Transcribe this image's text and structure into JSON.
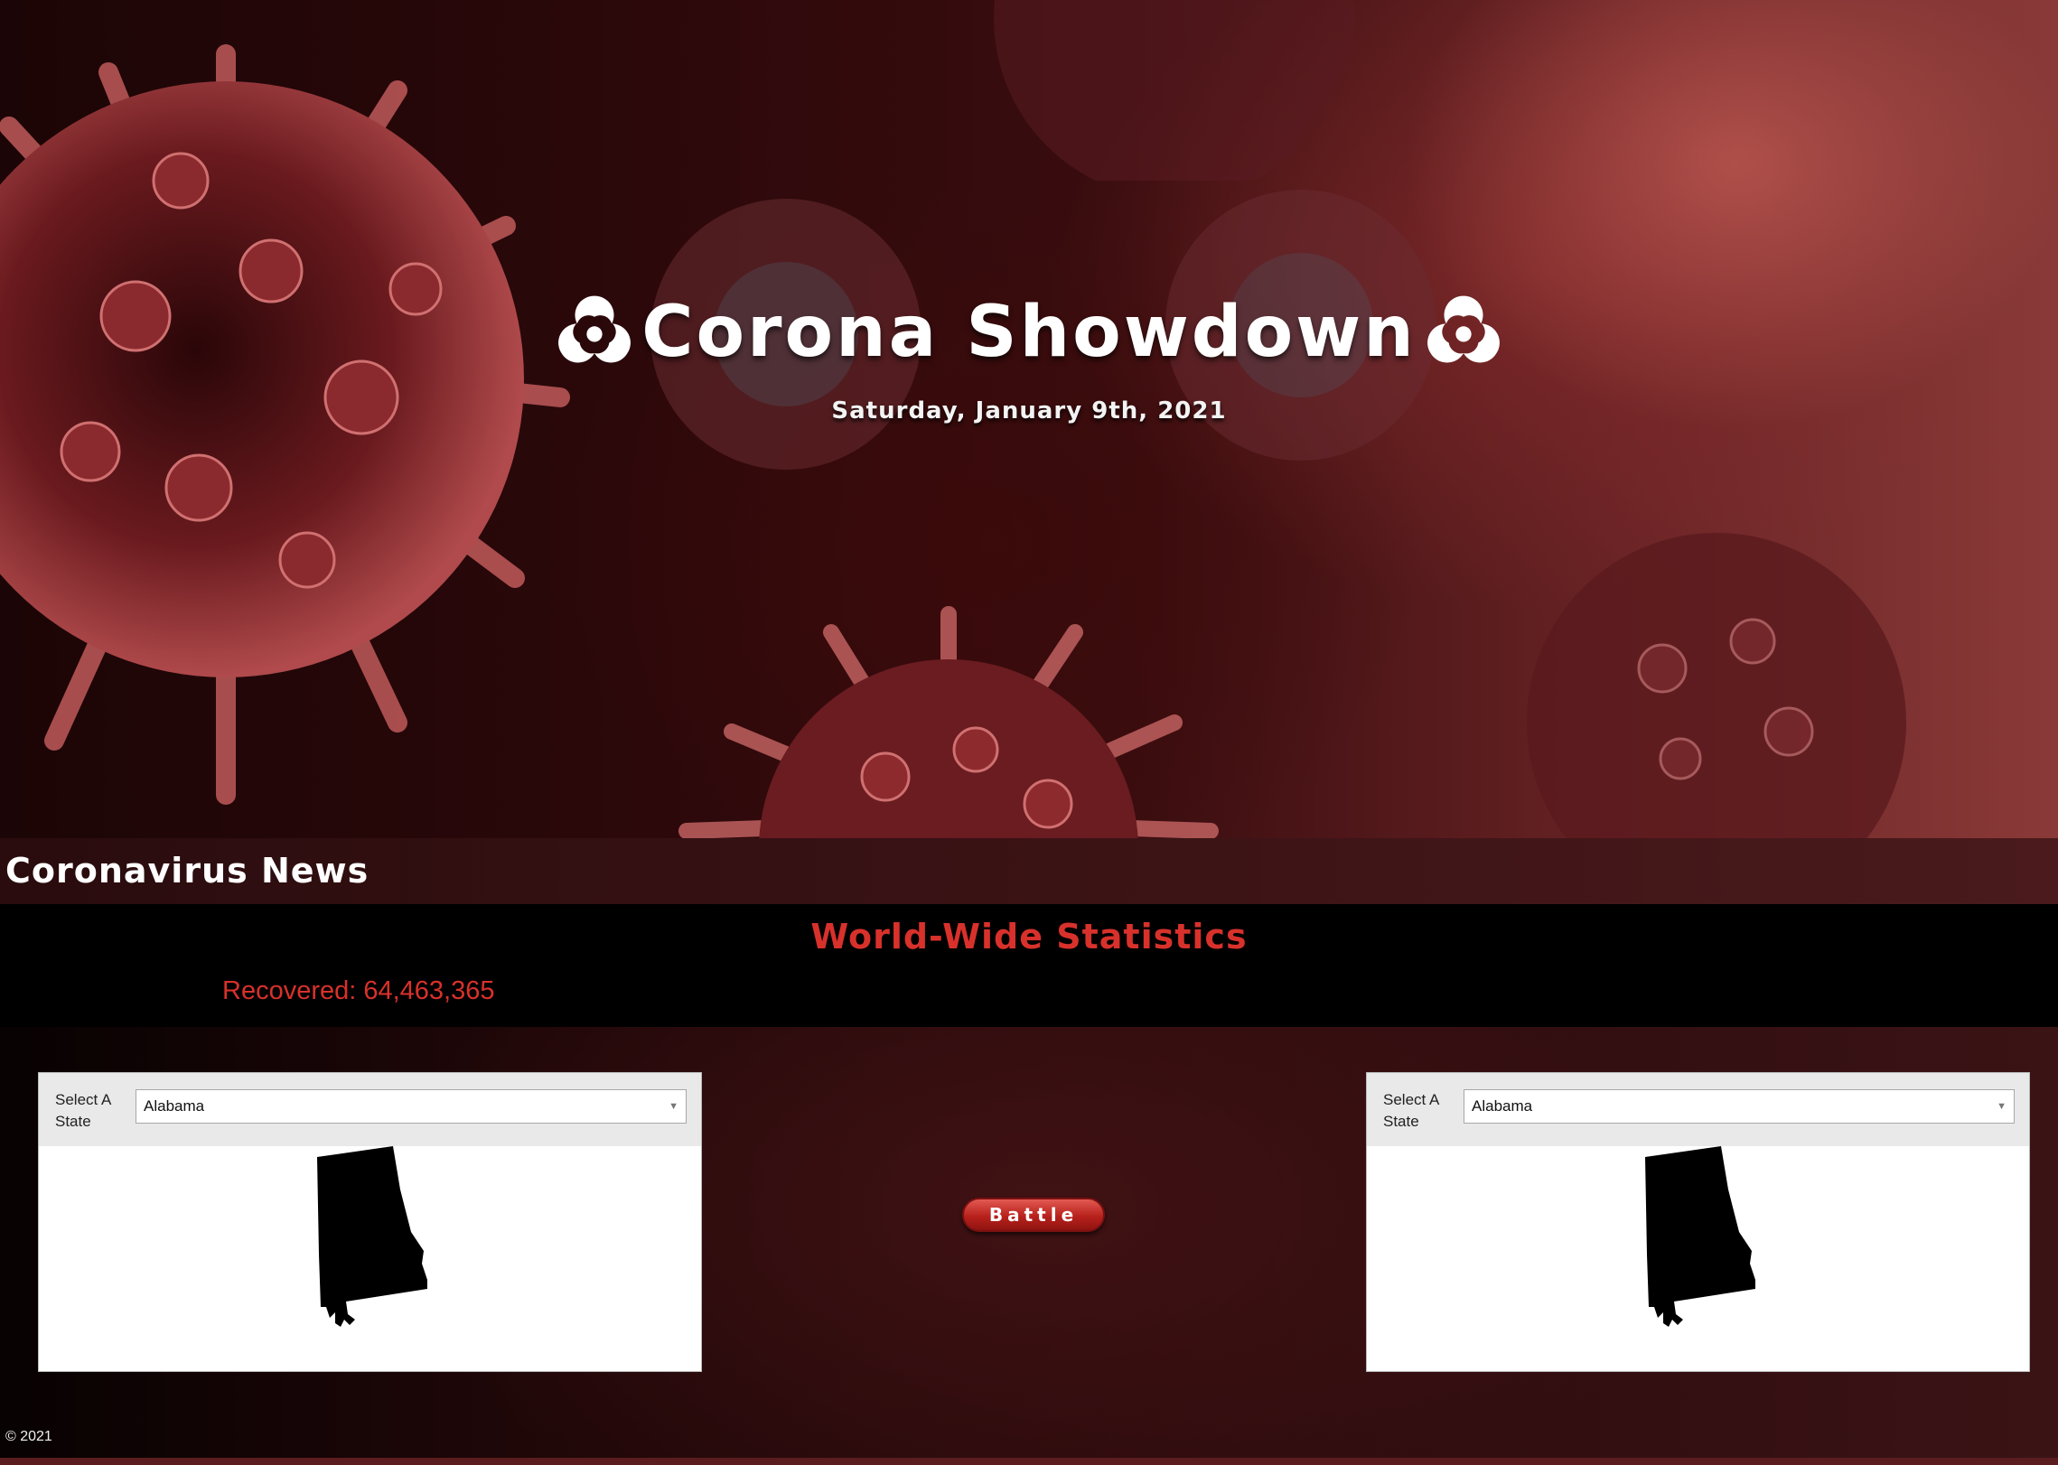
{
  "hero": {
    "title": "Corona Showdown",
    "date": "Saturday, January 9th, 2021",
    "left_icon": "biohazard-icon",
    "right_icon": "biohazard-icon"
  },
  "news": {
    "title": "Coronavirus News"
  },
  "stats": {
    "title": "World-Wide Statistics",
    "recovered": "Recovered: 64,463,365"
  },
  "left_panel": {
    "label": "Select A State",
    "selected": "Alabama"
  },
  "right_panel": {
    "label": "Select A State",
    "selected": "Alabama"
  },
  "battle": {
    "label": "Battle"
  },
  "footer": {
    "copyright": "© 2021"
  },
  "colors": {
    "accent_red": "#d8312b",
    "button_red": "#b8211c",
    "background_dark": "#1a0808"
  }
}
